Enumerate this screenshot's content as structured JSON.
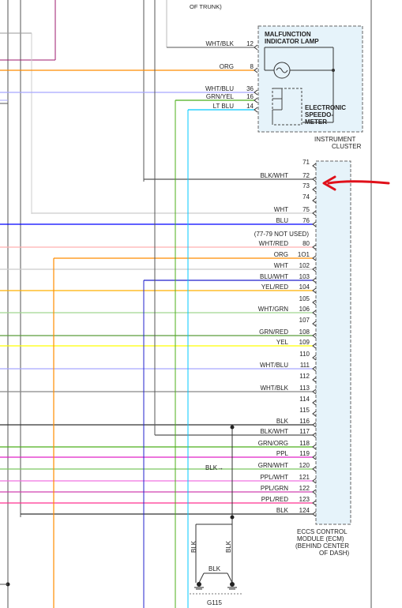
{
  "header": {
    "top_text_line2": "OF TRUNK)"
  },
  "instrument_cluster": {
    "mil_line1": "MALFUNCTION",
    "mil_line2": "INDICATOR LAMP",
    "speedo_line1": "ELECTRONIC",
    "speedo_line2": "SPEEDO-",
    "speedo_line3": "METER",
    "caption_line1": "INSTRUMENT",
    "caption_line2": "CLUSTER",
    "fill_color": "#e6f3fa"
  },
  "cluster_wires": [
    {
      "pin": "12",
      "label": "WHT/BLK",
      "color": "#777777"
    },
    {
      "pin": "8",
      "label": "ORG",
      "color": "#ff8c00"
    },
    {
      "pin": "36",
      "label": "WHT/BLU",
      "color": "#a8a8ff"
    },
    {
      "pin": "16",
      "label": "GRN/YEL",
      "color": "#4caf1a"
    },
    {
      "pin": "14",
      "label": "LT BLU",
      "color": "#00c8ff"
    }
  ],
  "ecm": {
    "caption_line1": "ECCS CONTROL",
    "caption_line2": "MODULE (ECM)",
    "caption_line3": "(BEHIND CENTER",
    "caption_line4": "OF DASH)",
    "fill_color": "#e6f3fa",
    "pins": [
      {
        "pin": "71",
        "label": "",
        "color": ""
      },
      {
        "pin": "72",
        "label": "BLK/WHT",
        "color": "#555555"
      },
      {
        "pin": "73",
        "label": "",
        "color": ""
      },
      {
        "pin": "74",
        "label": "",
        "color": ""
      },
      {
        "pin": "75",
        "label": "WHT",
        "color": "#cccccc"
      },
      {
        "pin": "76",
        "label": "BLU",
        "color": "#0000ff"
      },
      {
        "pin": "",
        "label": "(77-79 NOT USED)",
        "color": ""
      },
      {
        "pin": "80",
        "label": "WHT/RED",
        "color": "#ffb0b0"
      },
      {
        "pin": "1O1",
        "label": "ORG",
        "color": "#ff8c00"
      },
      {
        "pin": "102",
        "label": "WHT",
        "color": "#cccccc"
      },
      {
        "pin": "103",
        "label": "BLU/WHT",
        "color": "#2222cc"
      },
      {
        "pin": "104",
        "label": "YEL/RED",
        "color": "#ffb000"
      },
      {
        "pin": "105",
        "label": "",
        "color": ""
      },
      {
        "pin": "106",
        "label": "WHT/GRN",
        "color": "#a0d890"
      },
      {
        "pin": "107",
        "label": "",
        "color": ""
      },
      {
        "pin": "108",
        "label": "GRN/RED",
        "color": "#5a9e3a"
      },
      {
        "pin": "109",
        "label": "YEL",
        "color": "#ffff00"
      },
      {
        "pin": "110",
        "label": "",
        "color": ""
      },
      {
        "pin": "111",
        "label": "WHT/BLU",
        "color": "#a8a8ff"
      },
      {
        "pin": "112",
        "label": "",
        "color": ""
      },
      {
        "pin": "113",
        "label": "WHT/BLK",
        "color": "#888888"
      },
      {
        "pin": "114",
        "label": "",
        "color": ""
      },
      {
        "pin": "115",
        "label": "",
        "color": ""
      },
      {
        "pin": "116",
        "label": "BLK",
        "color": "#333333"
      },
      {
        "pin": "117",
        "label": "BLK/WHT",
        "color": "#555555"
      },
      {
        "pin": "118",
        "label": "GRN/ORG",
        "color": "#4caf1a"
      },
      {
        "pin": "119",
        "label": "PPL",
        "color": "#e020c8"
      },
      {
        "pin": "120",
        "label": "GRN/WHT",
        "color": "#7cc860"
      },
      {
        "pin": "121",
        "label": "PPL/WHT",
        "color": "#f070e0"
      },
      {
        "pin": "122",
        "label": "PPL/GRN",
        "color": "#d040b0"
      },
      {
        "pin": "123",
        "label": "PPL/RED",
        "color": "#ff3090"
      },
      {
        "pin": "124",
        "label": "BLK",
        "color": "#333333"
      }
    ]
  },
  "annotations": {
    "blk_arrow": "BLK→",
    "ground_vertical_left": "BLK",
    "ground_vertical_right": "BLK",
    "ground_bridge": "BLK",
    "ground_id": "G115",
    "arrow_color": "#e0101a"
  }
}
